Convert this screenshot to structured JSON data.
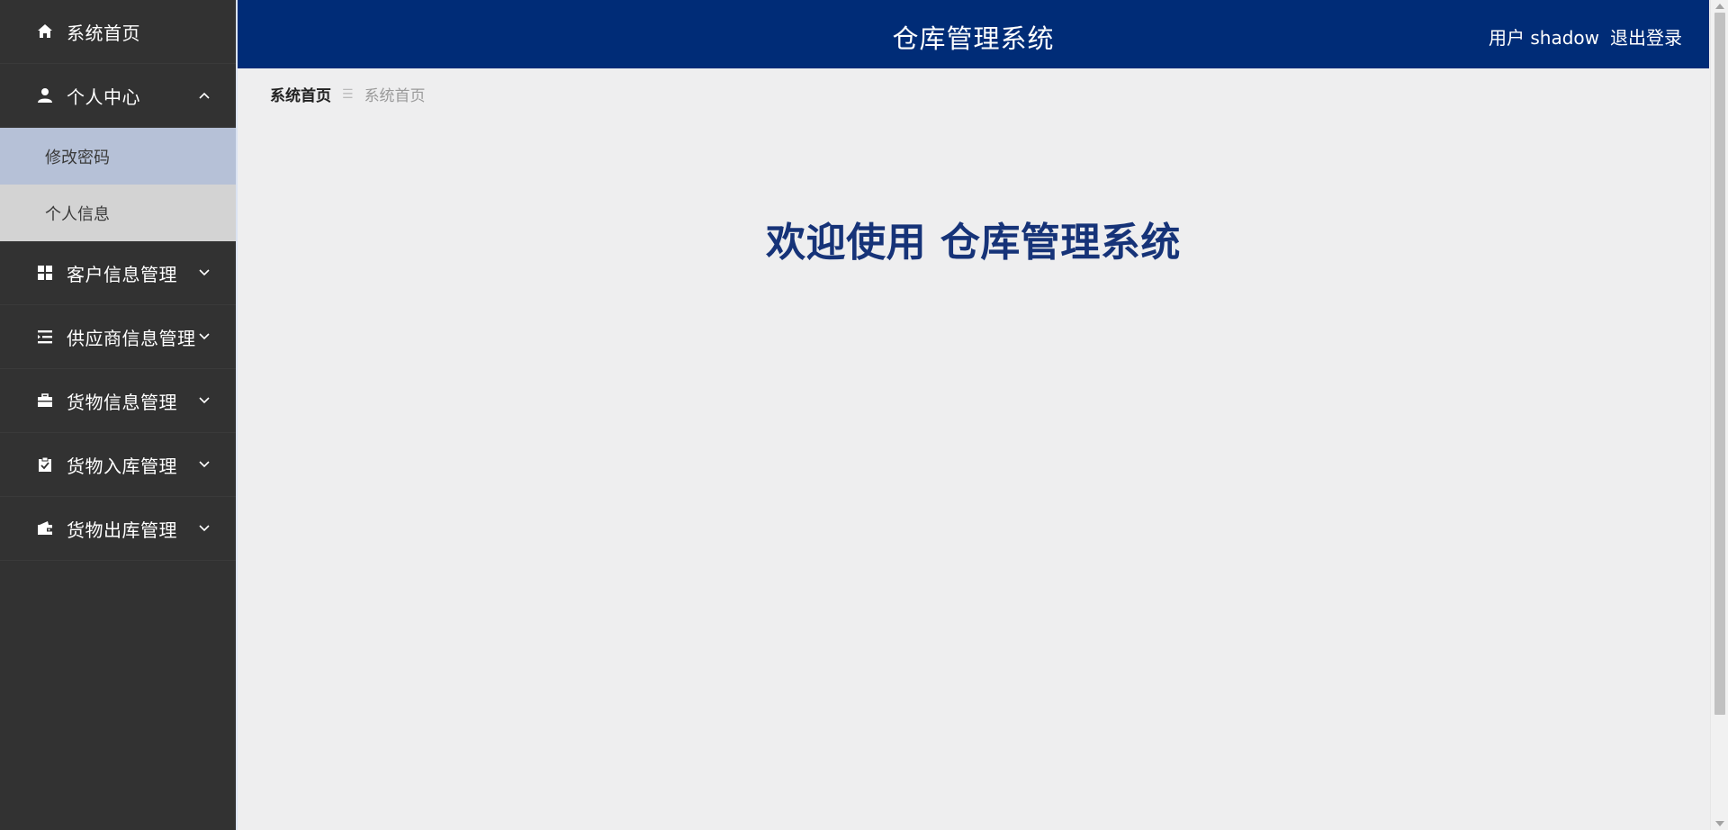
{
  "header": {
    "title": "仓库管理系统",
    "user_label": "用户 shadow",
    "logout_label": "退出登录"
  },
  "sidebar": {
    "items": [
      {
        "label": "系统首页",
        "icon": "home-icon"
      },
      {
        "label": "个人中心",
        "icon": "user-icon",
        "expanded": true,
        "children": [
          {
            "label": "修改密码",
            "active": true
          },
          {
            "label": "个人信息",
            "active": false
          }
        ]
      },
      {
        "label": "客户信息管理",
        "icon": "grid-icon"
      },
      {
        "label": "供应商信息管理",
        "icon": "list-icon"
      },
      {
        "label": "货物信息管理",
        "icon": "briefcase-icon"
      },
      {
        "label": "货物入库管理",
        "icon": "clipboard-check-icon"
      },
      {
        "label": "货物出库管理",
        "icon": "wallet-icon"
      }
    ]
  },
  "breadcrumb": {
    "home": "系统首页",
    "separator": "☰",
    "current": "系统首页"
  },
  "main": {
    "welcome_text": "欢迎使用 仓库管理系统"
  },
  "colors": {
    "header_bg": "#002c77",
    "sidebar_bg": "#323232",
    "submenu_active": "#b6c1d7",
    "submenu_normal": "#d3d3d3",
    "welcome_text": "#163378",
    "page_bg": "#eeeeef"
  }
}
